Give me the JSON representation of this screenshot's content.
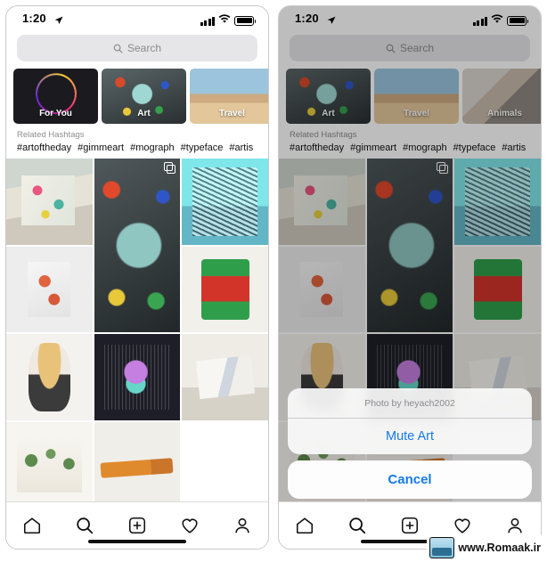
{
  "watermark": {
    "text": "www.Romaak.ir",
    "logo_icon": "site-logo-icon"
  },
  "phones": [
    {
      "id": "left",
      "status": {
        "time": "1:20",
        "location_icon": "location-arrow-icon",
        "signal_icon": "cellular-signal-icon",
        "wifi_icon": "wifi-icon",
        "battery_icon": "battery-full-icon"
      },
      "search": {
        "placeholder": "Search",
        "icon": "search-icon"
      },
      "categories": [
        {
          "label": "For You",
          "style": "chip-foryou",
          "avatar_icon": "story-ring-avatar-icon"
        },
        {
          "label": "Art",
          "style": "chip-art"
        },
        {
          "label": "Travel",
          "style": "chip-travel"
        },
        {
          "label": "",
          "style": "chip-animals"
        }
      ],
      "related_label": "Related Hashtags",
      "hashtags": [
        "#artoftheday",
        "#gimmeart",
        "#mograph",
        "#typeface",
        "#artis"
      ],
      "tabbar": [
        {
          "icon": "home-icon",
          "label": "Home"
        },
        {
          "icon": "search-icon",
          "label": "Search"
        },
        {
          "icon": "add-post-icon",
          "label": "New Post"
        },
        {
          "icon": "heart-icon",
          "label": "Activity"
        },
        {
          "icon": "profile-icon",
          "label": "Profile"
        }
      ],
      "home_indicator": "home-indicator"
    },
    {
      "id": "right",
      "status": {
        "time": "1:20",
        "location_icon": "location-arrow-icon",
        "signal_icon": "cellular-signal-icon",
        "wifi_icon": "wifi-icon",
        "battery_icon": "battery-full-icon"
      },
      "search": {
        "placeholder": "Search",
        "icon": "search-icon"
      },
      "categories": [
        {
          "label": "Art",
          "style": "chip-art"
        },
        {
          "label": "Travel",
          "style": "chip-travel"
        },
        {
          "label": "Animals",
          "style": "chip-animals"
        },
        {
          "label": "",
          "style": "chip-peek"
        }
      ],
      "related_label": "Related Hashtags",
      "hashtags": [
        "#artoftheday",
        "#gimmeart",
        "#mograph",
        "#typeface",
        "#artis"
      ],
      "action_sheet": {
        "title": "Photo by heyach2002",
        "primary_action": "Mute Art",
        "cancel_action": "Cancel"
      },
      "tabbar": [
        {
          "icon": "home-icon",
          "label": "Home"
        },
        {
          "icon": "search-icon",
          "label": "Search"
        },
        {
          "icon": "add-post-icon",
          "label": "New Post"
        },
        {
          "icon": "heart-icon",
          "label": "Activity"
        },
        {
          "icon": "profile-icon",
          "label": "Profile"
        }
      ],
      "home_indicator": "home-indicator"
    }
  ],
  "grid": {
    "cells": [
      {
        "name": "paint-palette-photo",
        "art": "a1",
        "multi": false
      },
      {
        "name": "splattered-paint-bowl-photo",
        "art": "a2",
        "multi": true,
        "tall": true
      },
      {
        "name": "cyan-linocut-photo",
        "art": "a3",
        "multi": false
      },
      {
        "name": "koi-fish-drawing-photo",
        "art": "a4",
        "multi": false
      },
      {
        "name": "robot-sculpture-photo",
        "art": "a5",
        "multi": false
      },
      {
        "name": "portrait-ink-drawing-photo",
        "art": "a6",
        "multi": false
      },
      {
        "name": "neon-face-artwork-photo",
        "art": "a7",
        "multi": false
      },
      {
        "name": "sketchbook-pencil-photo",
        "art": "a8",
        "multi": false
      },
      {
        "name": "tree-sketch-photo",
        "art": "a9",
        "multi": false
      },
      {
        "name": "orange-marker-photo",
        "art": "a10",
        "multi": false
      }
    ]
  }
}
